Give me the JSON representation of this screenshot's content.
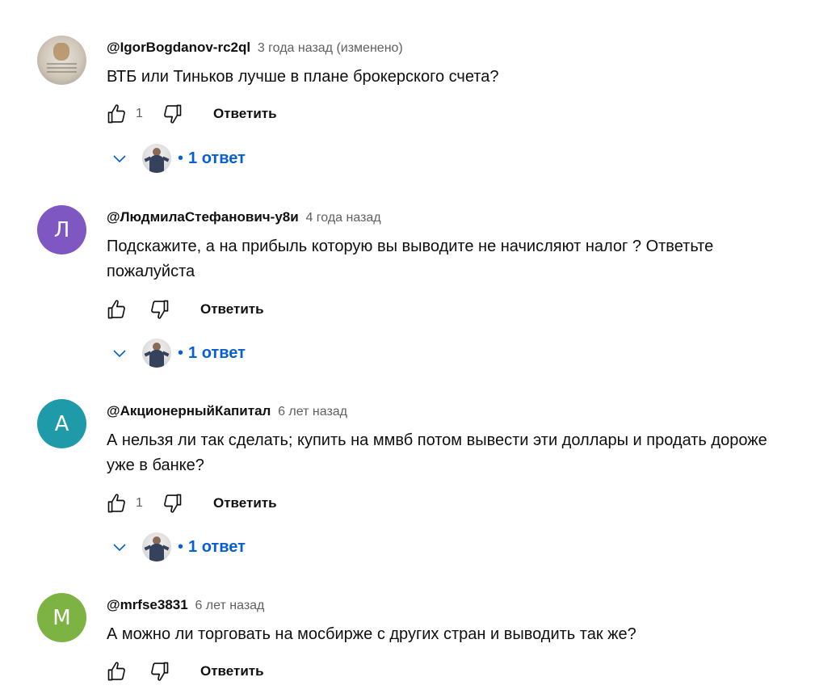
{
  "ui": {
    "reply_label": "Ответить",
    "replies_separator": "•",
    "icons": {
      "like": "thumbs-up-icon",
      "dislike": "thumbs-down-icon",
      "expand": "chevron-down-icon"
    },
    "colors": {
      "link_blue": "#065fd4",
      "meta_gray": "#606060",
      "text": "#0f0f0f"
    }
  },
  "comments": [
    {
      "author": "@IgorBogdanov-rc2ql",
      "time": "3 года назад (изменено)",
      "text": "ВТБ или Тиньков лучше в плане брокерского счета?",
      "likes": "1",
      "replies": "1 ответ",
      "avatar": {
        "type": "photo"
      }
    },
    {
      "author": "@ЛюдмилаСтефанович-у8и",
      "time": "4 года назад",
      "text": "Подскажите, а на прибыль которую вы выводите не начисляют налог ? Ответьте пожалуйста",
      "likes": "",
      "replies": "1 ответ",
      "avatar": {
        "type": "letter",
        "letter": "Л",
        "color": "#7e57c2"
      }
    },
    {
      "author": "@АкционерныйКапитал",
      "time": "6 лет назад",
      "text": "А нельзя ли так сделать; купить на ммвб потом вывести эти доллары и продать дороже уже в банке?",
      "likes": "1",
      "replies": "1 ответ",
      "avatar": {
        "type": "letter",
        "letter": "А",
        "color": "#1f9aa8"
      }
    },
    {
      "author": "@mrfse3831",
      "time": "6 лет назад",
      "text": "А можно ли торговать на мосбирже с других стран и выводить так же?",
      "likes": "",
      "replies": "",
      "avatar": {
        "type": "letter",
        "letter": "М",
        "color": "#7cb342"
      }
    }
  ]
}
